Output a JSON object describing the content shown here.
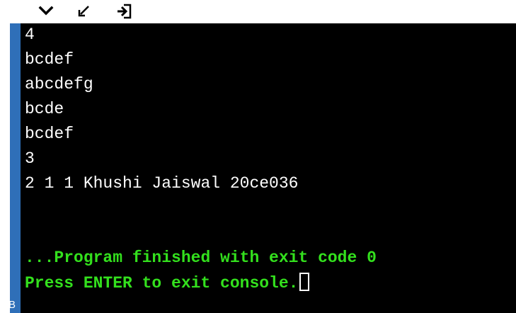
{
  "toolbar": {
    "icons": [
      "chevron-down-icon",
      "minimize-arrow-icon",
      "exit-console-icon"
    ]
  },
  "sidebar": {
    "corner_label": "B"
  },
  "console": {
    "output_lines": [
      "4",
      "bcdef",
      "abcdefg",
      "bcde",
      "bcdef",
      "3",
      "2 1 1 Khushi Jaiswal 20ce036"
    ],
    "status_line": "...Program finished with exit code 0",
    "prompt_line": "Press ENTER to exit console."
  },
  "colors": {
    "console_background": "#000000",
    "output_text": "#ffffff",
    "status_text": "#33e01d",
    "sidebar_accent": "#2f6fb8"
  }
}
